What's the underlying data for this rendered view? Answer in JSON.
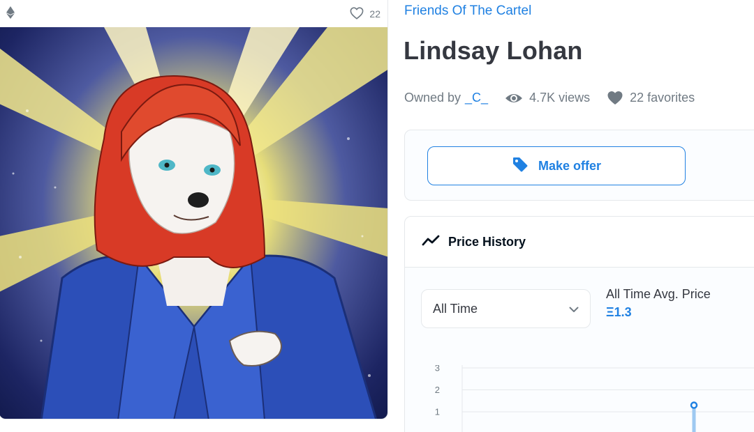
{
  "card": {
    "chain_icon": "ethereum-icon",
    "favorite_icon": "heart-outline-icon",
    "favorite_count": "22",
    "image_alt": "Lindsay Lohan artwork"
  },
  "collection": {
    "name": "Friends Of The Cartel"
  },
  "item": {
    "title": "Lindsay Lohan"
  },
  "meta": {
    "owned_by_label": "Owned by",
    "owner": "_C_",
    "views_icon": "eye-icon",
    "views": "4.7K views",
    "favorites_icon": "heart-filled-icon",
    "favorites": "22 favorites"
  },
  "offer": {
    "icon": "tag-icon",
    "label": "Make offer"
  },
  "price_history": {
    "icon": "trending-line-icon",
    "title": "Price History",
    "range_select": {
      "value": "All Time",
      "icon": "chevron-down-icon"
    },
    "avg_label": "All Time Avg. Price",
    "avg_value": "Ξ1.3"
  },
  "chart_data": {
    "type": "line",
    "title": "",
    "xlabel": "",
    "ylabel": "",
    "yticks": [
      "3",
      "2",
      "1"
    ],
    "ylim": [
      0,
      3
    ],
    "grid": true,
    "series": [
      {
        "values": [
          1.3
        ]
      }
    ]
  },
  "colors": {
    "accent": "#2081e2",
    "text": "#353840",
    "muted": "#707a83",
    "border": "#e5e8eb"
  }
}
